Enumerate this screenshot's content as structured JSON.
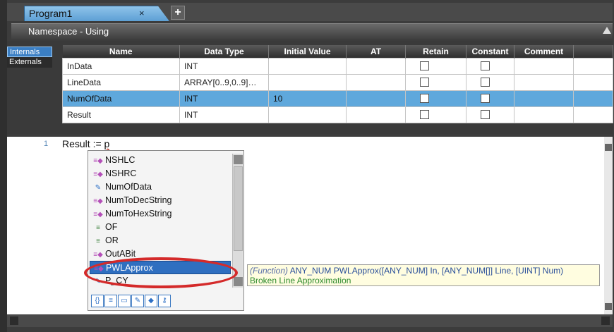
{
  "tab": {
    "title": "Program1",
    "close": "×",
    "add": "+"
  },
  "namespace": {
    "label": "Namespace - Using"
  },
  "var_tabs": [
    "Internals",
    "Externals"
  ],
  "grid": {
    "headers": [
      "Name",
      "Data Type",
      "Initial Value",
      "AT",
      "Retain",
      "Constant",
      "Comment"
    ],
    "rows": [
      {
        "name": "InData",
        "type": "INT",
        "initial": ""
      },
      {
        "name": "LineData",
        "type": "ARRAY[0..9,0..9]…",
        "initial": ""
      },
      {
        "name": "NumOfData",
        "type": "INT",
        "initial": "10",
        "selected": true
      },
      {
        "name": "Result",
        "type": "INT",
        "initial": ""
      }
    ]
  },
  "editor": {
    "line_number": "1",
    "code_prefix": "Result := ",
    "code_typed": "p"
  },
  "autocomplete": {
    "items": [
      {
        "label": "NSHLC",
        "icon": "function-icon"
      },
      {
        "label": "NSHRC",
        "icon": "function-icon"
      },
      {
        "label": "NumOfData",
        "icon": "variable-icon"
      },
      {
        "label": "NumToDecString",
        "icon": "function-icon"
      },
      {
        "label": "NumToHexString",
        "icon": "function-icon"
      },
      {
        "label": "OF",
        "icon": "operator-icon"
      },
      {
        "label": "OR",
        "icon": "operator-icon"
      },
      {
        "label": "OutABit",
        "icon": "function-icon"
      },
      {
        "label": "PWLApprox",
        "icon": "function-icon",
        "selected": true
      },
      {
        "label": "P_CY",
        "icon": "variable-icon"
      }
    ],
    "filters": [
      "{}",
      "≡",
      "▭",
      "✎",
      "◆",
      "⚷"
    ]
  },
  "tooltip": {
    "kind": "(Function)",
    "signature": " ANY_NUM PWLApprox([ANY_NUM] In, [ANY_NUM[]] Line, [UINT] Num)",
    "description": "Broken Line Approximation"
  },
  "colors": {
    "selection": "#2f6fc0",
    "highlight_ring": "#d42a2a",
    "row_selected": "#5fa8dc"
  }
}
